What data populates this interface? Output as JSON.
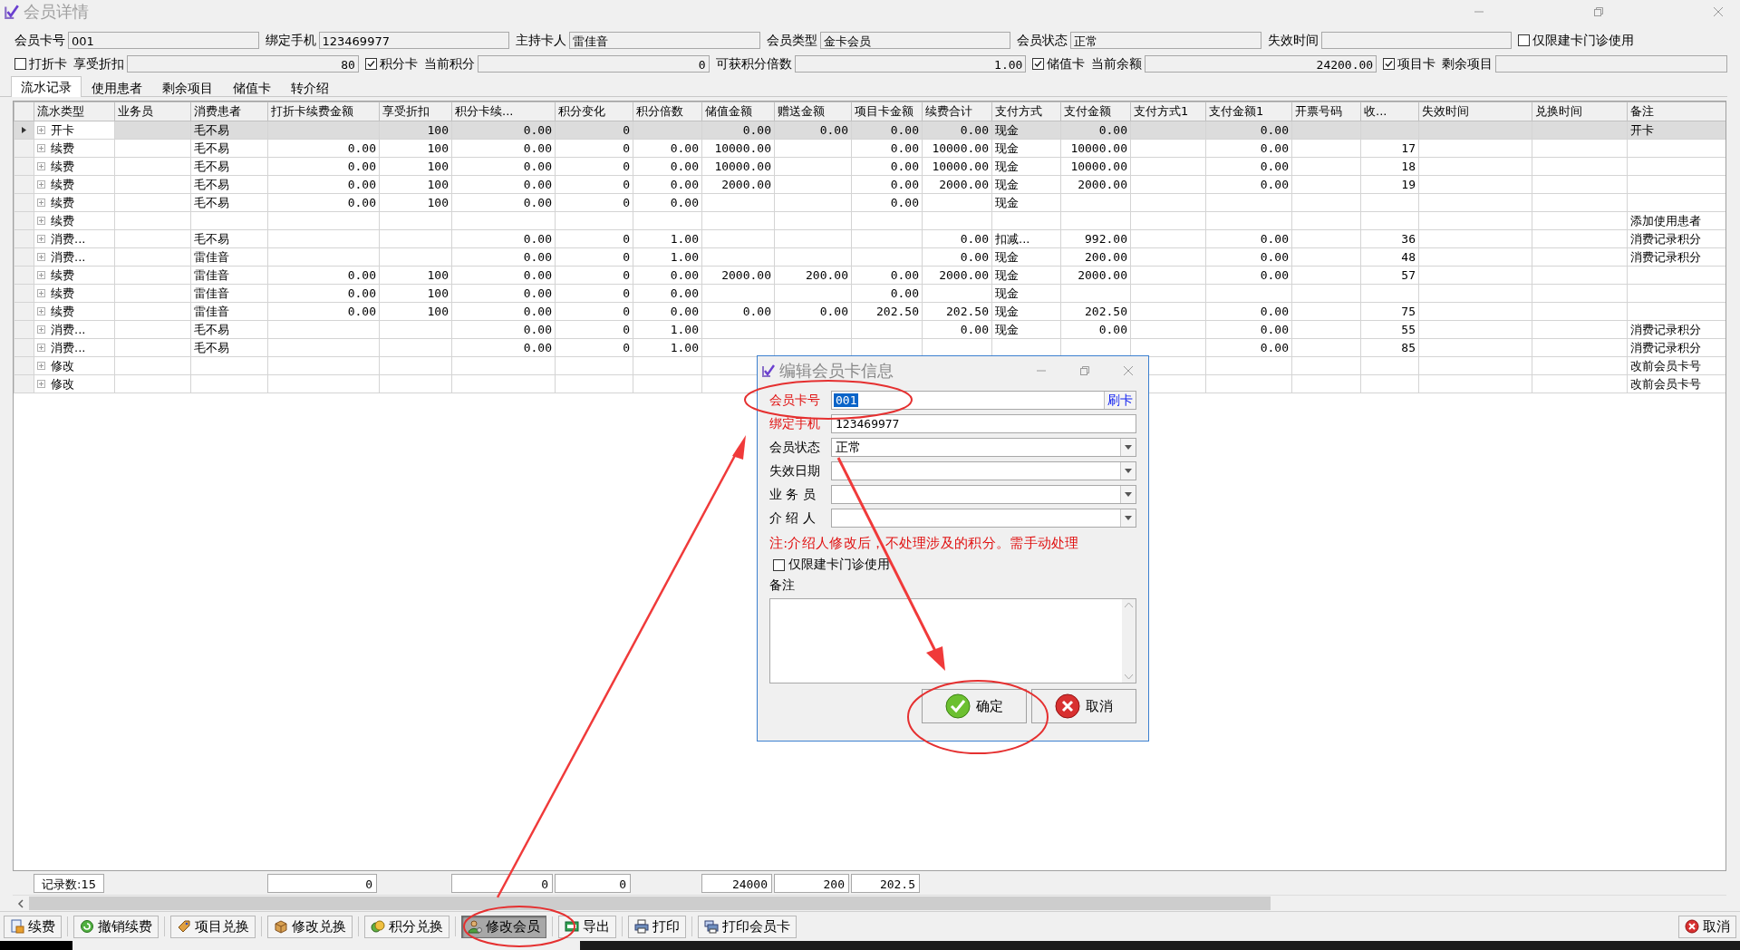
{
  "window": {
    "title": "会员详情"
  },
  "header": {
    "groups": [
      {
        "fields": [
          {
            "kind": "field",
            "label": "会员卡号",
            "value": "001"
          },
          {
            "kind": "field",
            "label": "绑定手机",
            "value": "123469977"
          },
          {
            "kind": "field",
            "label": "主持卡人",
            "value": "雷佳音"
          },
          {
            "kind": "field",
            "label": "会员类型",
            "value": "金卡会员"
          },
          {
            "kind": "field",
            "label": "会员状态",
            "value": "正常"
          },
          {
            "kind": "field",
            "label": "失效时间"
          },
          {
            "kind": "checkbox",
            "label": "仅限建卡门诊使用",
            "checked": false
          }
        ]
      },
      {
        "fields": [
          {
            "kind": "check_field",
            "check_label": "打折卡",
            "checked": false,
            "label": "享受折扣",
            "value": "80"
          },
          {
            "kind": "check_field",
            "check_label": "积分卡",
            "checked": true,
            "label": "当前积分",
            "value": "0"
          },
          {
            "kind": "amount_field",
            "label": "可获积分倍数",
            "value": "1.00"
          },
          {
            "kind": "check_field",
            "check_label": "储值卡",
            "checked": true,
            "label": "当前余额",
            "value": "24200.00"
          },
          {
            "kind": "check_field",
            "check_label": "项目卡",
            "checked": true,
            "label": "剩余项目"
          }
        ]
      }
    ]
  },
  "tabs": [
    {
      "label": "流水记录",
      "selected": true
    },
    {
      "label": "使用患者",
      "selected": false
    },
    {
      "label": "剩余项目",
      "selected": false
    },
    {
      "label": "储值卡",
      "selected": false
    },
    {
      "label": "转介绍",
      "selected": false
    }
  ],
  "table": {
    "columns": [
      {
        "label": "流水类型",
        "kind": "text"
      },
      {
        "label": "业务员",
        "kind": "text"
      },
      {
        "label": "消费患者",
        "kind": "text"
      },
      {
        "label": "打折卡续费金额",
        "kind": "number"
      },
      {
        "label": "享受折扣",
        "kind": "number"
      },
      {
        "label": "积分卡续...",
        "kind": "number"
      },
      {
        "label": "积分变化",
        "kind": "number"
      },
      {
        "label": "积分倍数",
        "kind": "number"
      },
      {
        "label": "储值金额",
        "kind": "number"
      },
      {
        "label": "赠送金额",
        "kind": "number"
      },
      {
        "label": "项目卡金额",
        "kind": "number"
      },
      {
        "label": "续费合计",
        "kind": "number"
      },
      {
        "label": "支付方式",
        "kind": "text"
      },
      {
        "label": "支付金额",
        "kind": "number"
      },
      {
        "label": "支付方式1",
        "kind": "text"
      },
      {
        "label": "支付金额1",
        "kind": "number"
      },
      {
        "label": "开票号码",
        "kind": "text"
      },
      {
        "label": "收...",
        "kind": "number"
      },
      {
        "label": "失效时间",
        "kind": "text"
      },
      {
        "label": "兑换时间",
        "kind": "text"
      },
      {
        "label": "备注",
        "kind": "text"
      }
    ],
    "rows": [
      {
        "selected": true,
        "cells": [
          "开卡",
          null,
          "毛不易",
          null,
          "100",
          "0.00",
          "0",
          null,
          "0.00",
          "0.00",
          "0.00",
          "0.00",
          "现金",
          "0.00",
          null,
          "0.00",
          null,
          null,
          null,
          null,
          "开卡"
        ]
      },
      {
        "selected": false,
        "cells": [
          "续费",
          null,
          "毛不易",
          "0.00",
          "100",
          "0.00",
          "0",
          "0.00",
          "10000.00",
          null,
          "0.00",
          "10000.00",
          "现金",
          "10000.00",
          null,
          "0.00",
          null,
          "17",
          null,
          null,
          null
        ]
      },
      {
        "selected": false,
        "cells": [
          "续费",
          null,
          "毛不易",
          "0.00",
          "100",
          "0.00",
          "0",
          "0.00",
          "10000.00",
          null,
          "0.00",
          "10000.00",
          "现金",
          "10000.00",
          null,
          "0.00",
          null,
          "18",
          null,
          null,
          null
        ]
      },
      {
        "selected": false,
        "cells": [
          "续费",
          null,
          "毛不易",
          "0.00",
          "100",
          "0.00",
          "0",
          "0.00",
          "2000.00",
          null,
          "0.00",
          "2000.00",
          "现金",
          "2000.00",
          null,
          "0.00",
          null,
          "19",
          null,
          null,
          null
        ]
      },
      {
        "selected": false,
        "cells": [
          "续费",
          null,
          "毛不易",
          "0.00",
          "100",
          "0.00",
          "0",
          "0.00",
          null,
          null,
          "0.00",
          null,
          "现金",
          null,
          null,
          null,
          null,
          null,
          null,
          null,
          null
        ]
      },
      {
        "selected": false,
        "cells": [
          "续费",
          null,
          null,
          null,
          null,
          null,
          null,
          null,
          null,
          null,
          null,
          null,
          null,
          null,
          null,
          null,
          null,
          null,
          null,
          null,
          "添加使用患者"
        ]
      },
      {
        "selected": false,
        "cells": [
          "消费...",
          null,
          "毛不易",
          null,
          null,
          "0.00",
          "0",
          "1.00",
          null,
          null,
          null,
          "0.00",
          "扣减...",
          "992.00",
          null,
          "0.00",
          null,
          "36",
          null,
          null,
          "消费记录积分"
        ]
      },
      {
        "selected": false,
        "cells": [
          "消费...",
          null,
          "雷佳音",
          null,
          null,
          "0.00",
          "0",
          "1.00",
          null,
          null,
          null,
          "0.00",
          "现金",
          "200.00",
          null,
          "0.00",
          null,
          "48",
          null,
          null,
          "消费记录积分"
        ]
      },
      {
        "selected": false,
        "cells": [
          "续费",
          null,
          "雷佳音",
          "0.00",
          "100",
          "0.00",
          "0",
          "0.00",
          "2000.00",
          "200.00",
          "0.00",
          "2000.00",
          "现金",
          "2000.00",
          null,
          "0.00",
          null,
          "57",
          null,
          null,
          null
        ]
      },
      {
        "selected": false,
        "cells": [
          "续费",
          null,
          "雷佳音",
          "0.00",
          "100",
          "0.00",
          "0",
          "0.00",
          null,
          null,
          "0.00",
          null,
          "现金",
          null,
          null,
          null,
          null,
          null,
          null,
          null,
          null
        ]
      },
      {
        "selected": false,
        "cells": [
          "续费",
          null,
          "雷佳音",
          "0.00",
          "100",
          "0.00",
          "0",
          "0.00",
          "0.00",
          "0.00",
          "202.50",
          "202.50",
          "现金",
          "202.50",
          null,
          "0.00",
          null,
          "75",
          null,
          null,
          null
        ]
      },
      {
        "selected": false,
        "cells": [
          "消费...",
          null,
          "毛不易",
          null,
          null,
          "0.00",
          "0",
          "1.00",
          null,
          null,
          null,
          "0.00",
          "现金",
          "0.00",
          null,
          "0.00",
          null,
          "55",
          null,
          null,
          "消费记录积分"
        ]
      },
      {
        "selected": false,
        "cells": [
          "消费...",
          null,
          "毛不易",
          null,
          null,
          "0.00",
          "0",
          "1.00",
          null,
          null,
          null,
          null,
          null,
          null,
          null,
          "0.00",
          null,
          "85",
          null,
          null,
          "消费记录积分"
        ]
      },
      {
        "selected": false,
        "cells": [
          "修改",
          null,
          null,
          null,
          null,
          null,
          null,
          null,
          null,
          null,
          null,
          null,
          null,
          null,
          null,
          null,
          null,
          null,
          null,
          null,
          "改前会员卡号"
        ]
      },
      {
        "selected": false,
        "cells": [
          "修改",
          null,
          null,
          null,
          null,
          null,
          null,
          null,
          null,
          null,
          null,
          null,
          null,
          null,
          null,
          null,
          null,
          null,
          null,
          null,
          "改前会员卡号"
        ]
      }
    ],
    "footer": {
      "record_count": "记录数:15",
      "totals": [
        {
          "value": "0"
        },
        {
          "value": "0"
        },
        {
          "value": "0"
        },
        {
          "value": "24000"
        },
        {
          "value": "200"
        },
        {
          "value": "202.5"
        }
      ]
    }
  },
  "toolbar": [
    {
      "label": "续费",
      "pressed": false
    },
    {
      "label": "撤销续费",
      "pressed": false
    },
    {
      "label": "项目兑换",
      "pressed": false
    },
    {
      "label": "修改兑换",
      "pressed": false
    },
    {
      "label": "积分兑换",
      "pressed": false
    },
    {
      "label": "修改会员",
      "pressed": true
    },
    {
      "label": "导出",
      "pressed": false
    },
    {
      "label": "打印",
      "pressed": false
    },
    {
      "label": "打印会员卡",
      "pressed": false
    },
    {
      "label": "取消",
      "pressed": false
    }
  ],
  "dialog": {
    "title": "编辑会员卡信息",
    "fields": [
      {
        "kind": "text",
        "label": "会员卡号",
        "required": true,
        "value": "001",
        "value_selected": true,
        "button": "刷卡"
      },
      {
        "kind": "text",
        "label": "绑定手机",
        "required": true,
        "value": "123469977",
        "value_selected": false
      },
      {
        "kind": "dropdown",
        "label": "会员状态",
        "required": false,
        "value": "正常"
      },
      {
        "kind": "dropdown",
        "label": "失效日期",
        "required": false
      },
      {
        "kind": "dropdown",
        "label": "业 务 员",
        "required": false
      },
      {
        "kind": "dropdown",
        "label": "介 绍 人",
        "required": false
      }
    ],
    "note": "注:介绍人修改后，不处理涉及的积分。需手动处理",
    "option": {
      "label": "仅限建卡门诊使用",
      "checked": false
    },
    "remarks_label": "备注",
    "buttons": [
      {
        "kind": "ok",
        "label": "确定"
      },
      {
        "kind": "cancel",
        "label": "取消"
      }
    ]
  }
}
